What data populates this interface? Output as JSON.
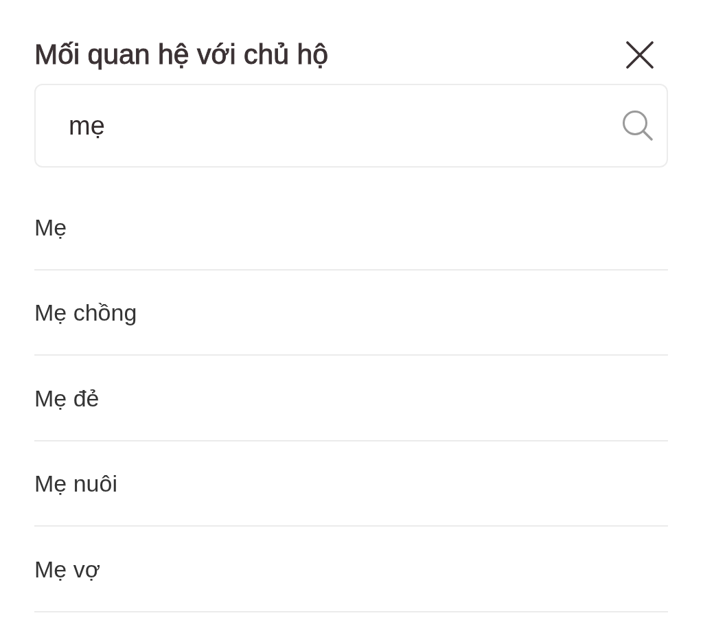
{
  "dialog": {
    "title": "Mối quan hệ với chủ hộ"
  },
  "search": {
    "value": "mẹ"
  },
  "options": [
    {
      "label": "Mẹ"
    },
    {
      "label": "Mẹ chồng"
    },
    {
      "label": "Mẹ đẻ"
    },
    {
      "label": "Mẹ nuôi"
    },
    {
      "label": "Mẹ vợ"
    }
  ]
}
